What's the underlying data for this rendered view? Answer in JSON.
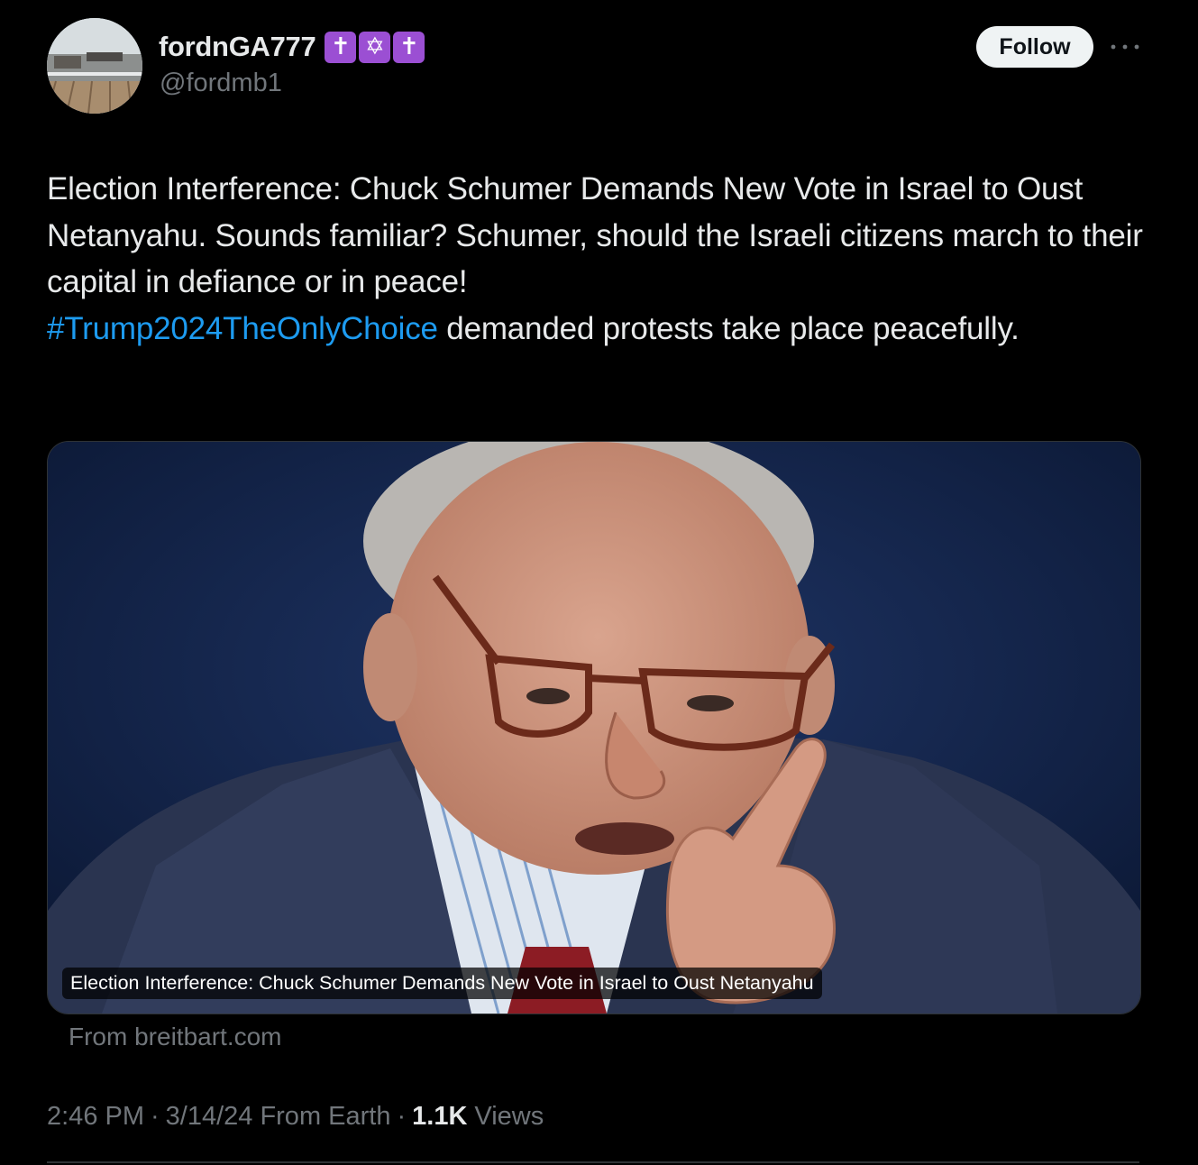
{
  "author": {
    "display_name": "fordnGA777",
    "handle": "@fordmb1",
    "badges": [
      "✝",
      "✡",
      "✝"
    ],
    "badge_color": "#9b4fd3",
    "avatar_icon": "boat-deck-photo-avatar"
  },
  "actions": {
    "follow_label": "Follow",
    "more_icon": "ellipsis-horizontal-icon"
  },
  "tweet": {
    "text_part1": "Election Interference: Chuck Schumer Demands New Vote in Israel to Oust Netanyahu. Sounds familiar? Schumer, should the Israeli citizens march to their capital in defiance or in peace!",
    "hashtag": "#Trump2024TheOnlyChoice",
    "text_part2": " demanded protests take place peacefully."
  },
  "card": {
    "caption": "Election Interference: Chuck Schumer Demands New Vote in Israel to Oust Netanyahu",
    "source": "From breitbart.com"
  },
  "meta": {
    "time": "2:46 PM",
    "date": "3/14/24",
    "origin": "From Earth",
    "views_count": "1.1K",
    "views_label": "Views",
    "separator": "·"
  },
  "colors": {
    "background": "#000000",
    "text": "#e7e9ea",
    "secondary": "#71767b",
    "link": "#1d9bf0",
    "follow_bg": "#eff3f4"
  }
}
